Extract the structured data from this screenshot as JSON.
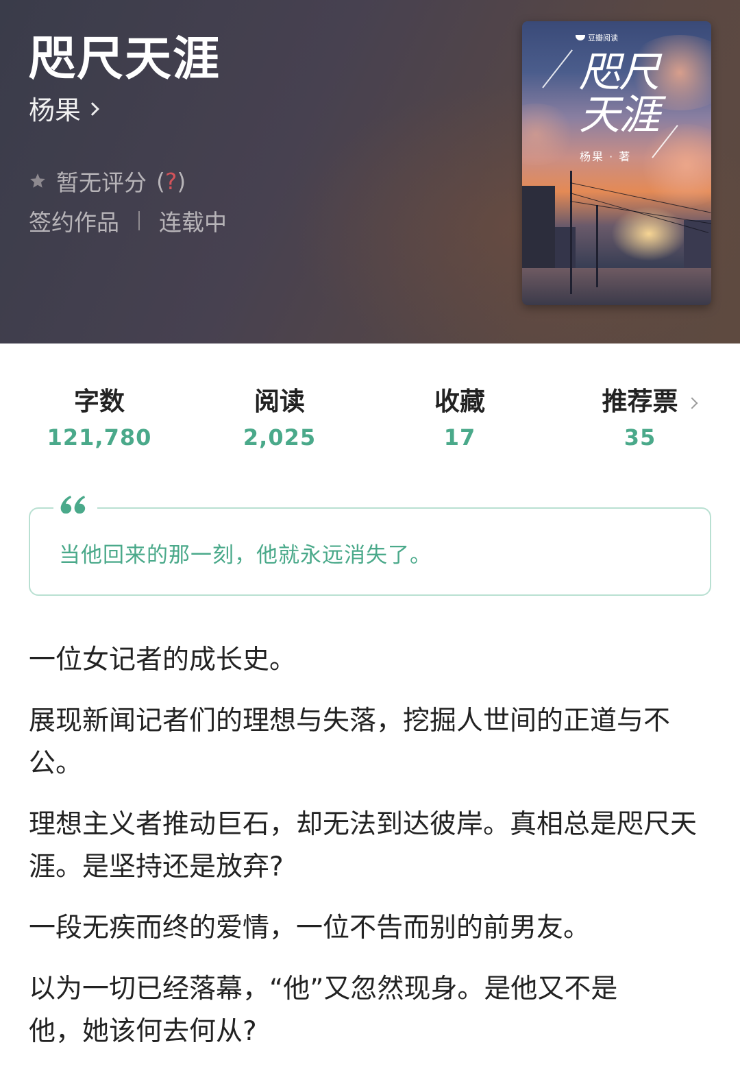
{
  "book": {
    "title": "咫尺天涯",
    "author": "杨果",
    "rating_text": "暂无评分",
    "rating_help_open": "(",
    "rating_help_q": "?",
    "rating_help_close": ")",
    "contract_status": "签约作品",
    "serial_status": "连载中"
  },
  "cover": {
    "brand": "豆瓣阅读",
    "title_line1": "咫尺",
    "title_line2": "天涯",
    "author_line": "杨果 · 著"
  },
  "stats": [
    {
      "label": "字数",
      "value": "121,780"
    },
    {
      "label": "阅读",
      "value": "2,025"
    },
    {
      "label": "收藏",
      "value": "17"
    },
    {
      "label": "推荐票",
      "value": "35"
    }
  ],
  "quote": {
    "text": "当他回来的那一刻，他就永远消失了。"
  },
  "synopsis": [
    "一位女记者的成长史。",
    "展现新闻记者们的理想与失落，挖掘人世间的正道与不公。",
    "理想主义者推动巨石，却无法到达彼岸。真相总是咫尺天涯。是坚持还是放弃?",
    "一段无疾而终的爱情，一位不告而别的前男友。",
    "以为一切已经落幕，“他”又忽然现身。是他又不是他，她该何去何从?"
  ],
  "colors": {
    "accent": "#4aa98a",
    "quote_border": "#b9e0d2",
    "header_bg": "#474150"
  },
  "icons": {
    "author_link": "chevron-right-icon",
    "rating": "star-icon",
    "quote": "quote-mark-icon",
    "recommend": "chevron-right-icon"
  }
}
